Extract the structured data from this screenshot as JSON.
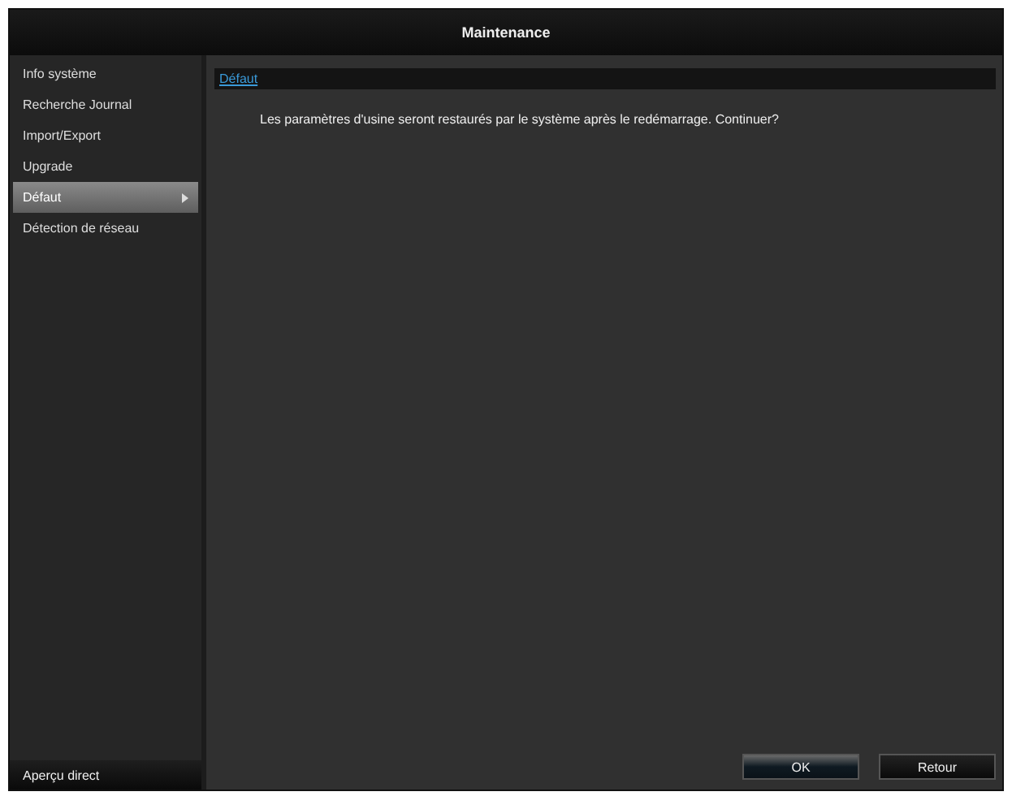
{
  "window": {
    "title": "Maintenance"
  },
  "sidebar": {
    "items": [
      {
        "label": "Info système",
        "selected": false
      },
      {
        "label": "Recherche Journal",
        "selected": false
      },
      {
        "label": "Import/Export",
        "selected": false
      },
      {
        "label": "Upgrade",
        "selected": false
      },
      {
        "label": "Défaut",
        "selected": true
      },
      {
        "label": "Détection de réseau",
        "selected": false
      }
    ],
    "footer": "Aperçu direct"
  },
  "tabs": [
    {
      "label": "Défaut",
      "selected": true
    }
  ],
  "message": "Les paramètres d'usine seront restaurés par le système après le redémarrage. Continuer?",
  "buttons": [
    {
      "label": "OK",
      "selected": true
    },
    {
      "label": "Retour",
      "selected": false
    }
  ]
}
